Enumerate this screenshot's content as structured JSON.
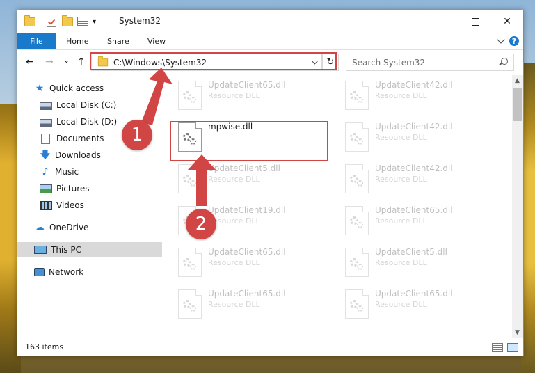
{
  "window": {
    "title": "System32"
  },
  "ribbon": {
    "tabs": [
      "File",
      "Home",
      "Share",
      "View"
    ],
    "help": "?"
  },
  "nav": {
    "address": "C:\\Windows\\System32",
    "search_placeholder": "Search System32",
    "back": "←",
    "forward": "→",
    "recent": "⌄",
    "up": "↑",
    "refresh": "↻"
  },
  "sidebar": {
    "items": [
      {
        "label": "Quick access",
        "icon": "star-icon",
        "pinned": false
      },
      {
        "label": "Local Disk (C:)",
        "icon": "drive-icon",
        "pinned": false
      },
      {
        "label": "Local Disk (D:)",
        "icon": "drive-icon",
        "pinned": false
      },
      {
        "label": "Documents",
        "icon": "document-icon",
        "pinned": false
      },
      {
        "label": "Downloads",
        "icon": "download-icon",
        "pinned": true
      },
      {
        "label": "Music",
        "icon": "music-icon",
        "pinned": true
      },
      {
        "label": "Pictures",
        "icon": "pictures-icon",
        "pinned": true
      },
      {
        "label": "Videos",
        "icon": "videos-icon",
        "pinned": true
      },
      {
        "label": "OneDrive",
        "icon": "cloud-icon",
        "pinned": false
      },
      {
        "label": "This PC",
        "icon": "computer-icon",
        "pinned": false
      },
      {
        "label": "Network",
        "icon": "network-icon",
        "pinned": false
      }
    ],
    "pin_glyph": "📌"
  },
  "files": [
    {
      "name": "UpdateClient65.dll",
      "type": "Resource DLL"
    },
    {
      "name": "UpdateClient42.dll",
      "type": "Resource DLL"
    },
    {
      "name": "mpwise.dll",
      "type": ""
    },
    {
      "name": "UpdateClient42.dll",
      "type": "Resource DLL"
    },
    {
      "name": "UpdateClient5.dll",
      "type": "Resource DLL"
    },
    {
      "name": "UpdateClient42.dll",
      "type": "Resource DLL"
    },
    {
      "name": "UpdateClient19.dll",
      "type": "Resource DLL"
    },
    {
      "name": "UpdateClient65.dll",
      "type": "Resource DLL"
    },
    {
      "name": "UpdateClient65.dll",
      "type": "Resource DLL"
    },
    {
      "name": "UpdateClient5.dll",
      "type": "Resource DLL"
    },
    {
      "name": "UpdateClient65.dll",
      "type": "Resource DLL"
    },
    {
      "name": "UpdateClient65.dll",
      "type": "Resource DLL"
    }
  ],
  "status": {
    "count": "163 items"
  },
  "callouts": [
    "1",
    "2"
  ],
  "colors": {
    "accent": "#1979ca",
    "highlight": "#d24545"
  }
}
